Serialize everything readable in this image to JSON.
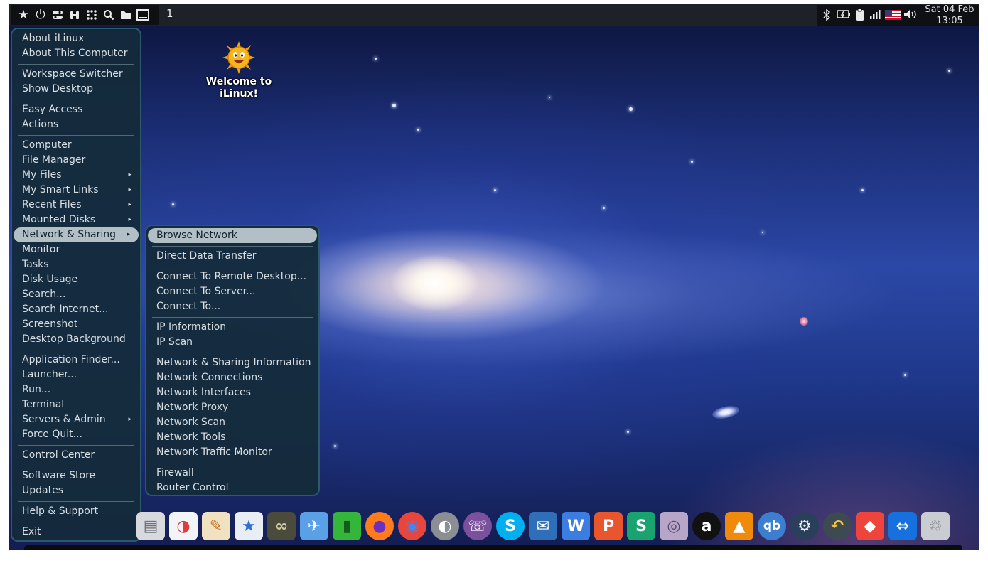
{
  "top_panel": {
    "workspace_number": "1",
    "clock": {
      "line1": "Sat 04 Feb",
      "line2": "13:05"
    },
    "launcher_icons": [
      "favorites-star-icon",
      "power-icon",
      "toggle-settings-icon",
      "binoculars-icon",
      "apps-grid-icon",
      "search-icon",
      "folder-icon",
      "show-desktop-icon"
    ],
    "tray_icons": [
      "bluetooth-icon",
      "battery-charging-icon",
      "clipboard-icon",
      "wifi-signal-icon",
      "us-flag-keyboard-icon",
      "volume-icon"
    ]
  },
  "desktop_icon": {
    "label_line1": "Welcome to",
    "label_line2": "iLinux!"
  },
  "main_menu": {
    "groups": [
      [
        {
          "label": "About iLinux"
        },
        {
          "label": "About This Computer"
        }
      ],
      [
        {
          "label": "Workspace Switcher"
        },
        {
          "label": "Show Desktop"
        }
      ],
      [
        {
          "label": "Easy Access"
        },
        {
          "label": "Actions"
        }
      ],
      [
        {
          "label": "Computer"
        },
        {
          "label": "File Manager"
        },
        {
          "label": "My Files",
          "arrow": "▸"
        },
        {
          "label": "My Smart Links",
          "arrow": "▸"
        },
        {
          "label": "Recent Files",
          "arrow": "▸"
        },
        {
          "label": "Mounted Disks",
          "arrow": "▸"
        },
        {
          "label": "Network & Sharing",
          "arrow": "▸",
          "highlighted": true
        },
        {
          "label": "Monitor"
        },
        {
          "label": "Tasks"
        },
        {
          "label": "Disk Usage"
        },
        {
          "label": "Search..."
        },
        {
          "label": "Search Internet..."
        },
        {
          "label": "Screenshot"
        },
        {
          "label": "Desktop Background"
        }
      ],
      [
        {
          "label": "Application Finder..."
        },
        {
          "label": "Launcher..."
        },
        {
          "label": "Run..."
        },
        {
          "label": "Terminal"
        },
        {
          "label": "Servers & Admin",
          "arrow": "▸"
        },
        {
          "label": "Force Quit..."
        }
      ],
      [
        {
          "label": "Control Center"
        }
      ],
      [
        {
          "label": "Software Store"
        },
        {
          "label": "Updates"
        }
      ],
      [
        {
          "label": "Help & Support"
        }
      ],
      [
        {
          "label": "Exit"
        }
      ]
    ]
  },
  "sub_menu": {
    "groups": [
      [
        {
          "label": "Browse Network",
          "highlighted": true
        }
      ],
      [
        {
          "label": "Direct Data Transfer"
        }
      ],
      [
        {
          "label": "Connect To Remote Desktop..."
        },
        {
          "label": "Connect To Server..."
        },
        {
          "label": "Connect To..."
        }
      ],
      [
        {
          "label": "IP Information"
        },
        {
          "label": "IP Scan"
        }
      ],
      [
        {
          "label": "Network & Sharing Information"
        },
        {
          "label": "Network Connections"
        },
        {
          "label": "Network Interfaces"
        },
        {
          "label": "Network Proxy"
        },
        {
          "label": "Network Scan"
        },
        {
          "label": "Network Tools"
        },
        {
          "label": "Network Traffic Monitor"
        }
      ],
      [
        {
          "label": "Firewall"
        },
        {
          "label": "Router Control"
        }
      ]
    ]
  },
  "dock": {
    "apps": [
      {
        "name": "file-cabinet",
        "icon": "file-cabinet-icon",
        "bg": "#d7d9dc",
        "fg": "#6c7078",
        "glyph": "▤"
      },
      {
        "name": "settings-toggle",
        "icon": "settings-toggle-icon",
        "bg": "#f2f4f7",
        "fg": "#e23b3b",
        "glyph": "◑"
      },
      {
        "name": "appearance",
        "icon": "color-palette-icon",
        "bg": "#f0e1c0",
        "fg": "#c4772a",
        "glyph": "✎"
      },
      {
        "name": "app-store",
        "icon": "app-store-bag-icon",
        "bg": "#e9eef5",
        "fg": "#2d6fd1",
        "glyph": "★"
      },
      {
        "name": "catfish-search",
        "icon": "binoculars-icon",
        "bg": "#4a4b3a",
        "fg": "#d0c7a2",
        "glyph": "∞"
      },
      {
        "name": "launcher-rocket",
        "icon": "rocket-icon",
        "bg": "#5aa0e6",
        "fg": "#f2f5fa",
        "glyph": "✈"
      },
      {
        "name": "warp-pipe",
        "icon": "green-pipe-icon",
        "bg": "#33b63a",
        "fg": "#145c19",
        "glyph": "▮"
      },
      {
        "name": "firefox",
        "icon": "firefox-icon",
        "bg": "#ff7b1c",
        "fg": "#6b2fc1",
        "glyph": "●"
      },
      {
        "name": "chrome",
        "icon": "chrome-icon",
        "bg": "#e8453c",
        "fg": "#4285f4",
        "glyph": "◉"
      },
      {
        "name": "google-earth-pro",
        "icon": "google-earth-pro-icon",
        "bg": "#8b8e94",
        "fg": "#ffffff",
        "glyph": "◐"
      },
      {
        "name": "viber",
        "icon": "viber-icon",
        "bg": "#7b519d",
        "fg": "#ffffff",
        "glyph": "☏"
      },
      {
        "name": "skype",
        "icon": "skype-icon",
        "bg": "#00aff0",
        "fg": "#ffffff",
        "glyph": "S"
      },
      {
        "name": "thunderbird",
        "icon": "thunderbird-icon",
        "bg": "#2f6fb9",
        "fg": "#ffffff",
        "glyph": "✉"
      },
      {
        "name": "wps-writer",
        "icon": "wps-writer-icon",
        "bg": "#3b7de0",
        "fg": "#ffffff",
        "glyph": "W"
      },
      {
        "name": "wps-presentation",
        "icon": "wps-presentation-icon",
        "bg": "#e9562d",
        "fg": "#ffffff",
        "glyph": "P"
      },
      {
        "name": "wps-spreadsheets",
        "icon": "wps-spreadsheets-icon",
        "bg": "#19a36f",
        "fg": "#ffffff",
        "glyph": "S"
      },
      {
        "name": "webcam-viewer",
        "icon": "webcam-photo-icon",
        "bg": "#b8a6c8",
        "fg": "#5c4a6d",
        "glyph": "◎"
      },
      {
        "name": "anydesk-a",
        "icon": "a-circle-icon",
        "bg": "#111111",
        "fg": "#ffffff",
        "glyph": "a"
      },
      {
        "name": "vlc",
        "icon": "vlc-cone-icon",
        "bg": "#f08a0c",
        "fg": "#ffffff",
        "glyph": "▲"
      },
      {
        "name": "qbittorrent",
        "icon": "qbittorrent-icon",
        "bg": "#3c7fd0",
        "fg": "#ffffff",
        "glyph": "qb"
      },
      {
        "name": "steam",
        "icon": "steam-icon",
        "bg": "#2a3f5a",
        "fg": "#e6edf5",
        "glyph": "⚙"
      },
      {
        "name": "timeshift-restore",
        "icon": "restore-arrow-icon",
        "bg": "#3e4a52",
        "fg": "#f3c43a",
        "glyph": "↶"
      },
      {
        "name": "anydesk",
        "icon": "anydesk-icon",
        "bg": "#ef443b",
        "fg": "#ffffff",
        "glyph": "◆"
      },
      {
        "name": "teamviewer",
        "icon": "teamviewer-icon",
        "bg": "#1670de",
        "fg": "#ffffff",
        "glyph": "⇔"
      },
      {
        "name": "trash",
        "icon": "trash-icon",
        "bg": "#c9cdd2",
        "fg": "#6d737b",
        "glyph": "♲"
      }
    ]
  }
}
